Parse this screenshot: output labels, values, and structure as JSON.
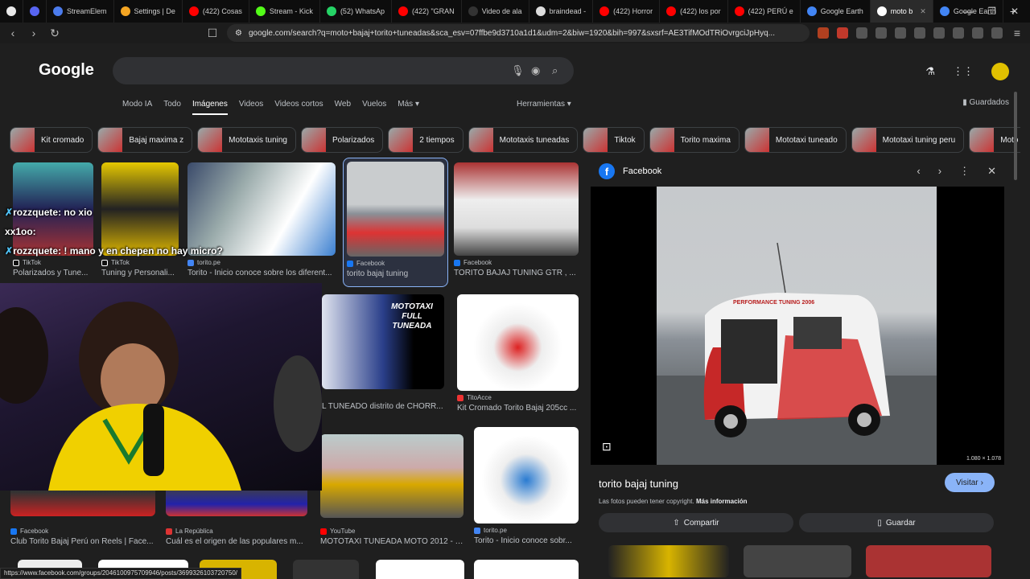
{
  "tabs": [
    {
      "label": "",
      "color": "#e8e8e8"
    },
    {
      "label": "",
      "color": "#5865f2"
    },
    {
      "label": "StreamElem",
      "color": "#4b7bec"
    },
    {
      "label": "Settings | De",
      "color": "#f5a623"
    },
    {
      "label": "(422) Cosas",
      "color": "#ff0000"
    },
    {
      "label": "Stream - Kick",
      "color": "#53fc18"
    },
    {
      "label": "(52) WhatsAp",
      "color": "#25d366"
    },
    {
      "label": "(422) \"GRAN",
      "color": "#ff0000"
    },
    {
      "label": "Video de ala",
      "color": "#000000"
    },
    {
      "label": "braindead -",
      "color": "#dddddd"
    },
    {
      "label": "(422) Horror",
      "color": "#ff0000"
    },
    {
      "label": "(422) los por",
      "color": "#ff0000"
    },
    {
      "label": "(422) PERÚ e",
      "color": "#ff0000"
    },
    {
      "label": "Google Earth",
      "color": "#4285f4"
    },
    {
      "label": "moto b",
      "color": "#ffffff",
      "active": true
    },
    {
      "label": "Google Earth",
      "color": "#4285f4"
    }
  ],
  "url": "google.com/search?q=moto+bajaj+torito+tuneadas&sca_esv=07ffbe9d3710a1d1&udm=2&biw=1920&bih=997&sxsrf=AE3TifMOdTRiOvrgciJpHyq...",
  "google": {
    "logo": "Google",
    "nav": [
      "Modo IA",
      "Todo",
      "Imágenes",
      "Videos",
      "Videos cortos",
      "Web",
      "Vuelos",
      "Más ▾"
    ],
    "tools": "Herramientas ▾",
    "saved": "Guardados"
  },
  "chips": [
    "Kit cromado",
    "Bajaj maxima z",
    "Mototaxis tuning",
    "Polarizados",
    "2 tiempos",
    "Mototaxis tuneadas",
    "Tiktok",
    "Torito maxima",
    "Mototaxi tuneado",
    "Mototaxi tuning peru",
    "Moto"
  ],
  "results": {
    "r1": {
      "source": "TikTok",
      "title": "Polarizados y Tune..."
    },
    "r2": {
      "source": "TikTok",
      "title": "Tuning y Personali..."
    },
    "r3": {
      "source": "torito.pe",
      "title": "Torito - Inicio conoce sobre los diferent..."
    },
    "r4": {
      "source": "Facebook",
      "title": "torito bajaj tuning"
    },
    "r5": {
      "source": "Facebook",
      "title": "TORITO BAJAJ TUNING GTR , ..."
    },
    "r6": {
      "overlay": "MOTOTAXI FULL TUNEADA",
      "title": "L TUNEADO distrito de CHORR..."
    },
    "r7": {
      "source": "TitoAcce",
      "title": "Kit Cromado Torito Bajaj 205cc ..."
    },
    "r8": {
      "source": "Facebook",
      "title": "Club Torito Bajaj Perú on Reels | Face..."
    },
    "r9": {
      "source": "La República",
      "title": "Cuál es el origen de las populares m..."
    },
    "r10": {
      "source": "YouTube",
      "title": "MOTOTAXI TUNEADA MOTO 2012 - Y..."
    },
    "r11": {
      "source": "torito.pe",
      "title": "Torito - Inicio conoce sobr..."
    }
  },
  "panel": {
    "source": "Facebook",
    "dims": "1.080 × 1.078",
    "photo_text": "PERFORMANCE TUNING 2006",
    "title": "torito bajaj tuning",
    "visit": "Visitar",
    "copyright": "Las fotos pueden tener copyright.",
    "more_info": "Más información",
    "share": "Compartir",
    "save": "Guardar"
  },
  "chat": [
    {
      "user": "rozzquete:",
      "msg": "no xio"
    },
    {
      "user": "xx1oo:",
      "msg": ""
    },
    {
      "user": "rozzquete:",
      "msg": "! mano y en chepen no hay micro?"
    }
  ],
  "status_url": "https://www.facebook.com/groups/2046100975709946/posts/3699326103720750/"
}
